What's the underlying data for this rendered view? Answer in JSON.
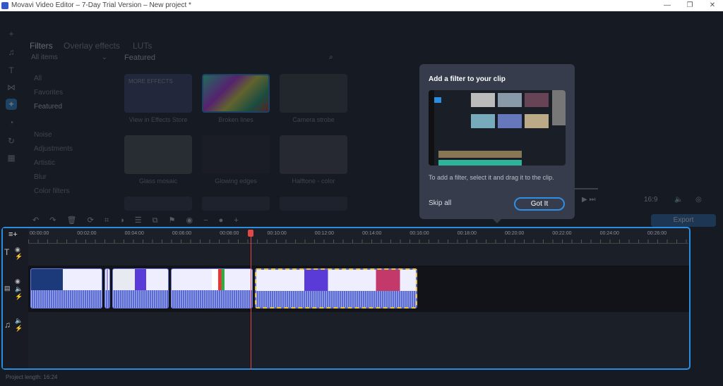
{
  "window": {
    "title": "Movavi Video Editor – 7-Day Trial Version – New project *"
  },
  "tabs": [
    "Filters",
    "Overlay effects",
    "LUTs"
  ],
  "category_select": "All items",
  "sidebar": [
    "All",
    "Favorites",
    "Featured",
    "Noise",
    "Adjustments",
    "Artistic",
    "Blur",
    "Color filters"
  ],
  "section_title": "Featured",
  "filters": [
    {
      "label": "View in Effects Store",
      "thumb_text": "MORE EFFECTS"
    },
    {
      "label": "Broken lines"
    },
    {
      "label": "Camera strobe"
    },
    {
      "label": "Glass mosaic"
    },
    {
      "label": "Glowing edges"
    },
    {
      "label": "Halftone - color"
    }
  ],
  "popup": {
    "title": "Add a filter to your clip",
    "text": "To add a filter, select it and drag it to the clip.",
    "skip": "Skip all",
    "confirm": "Got It"
  },
  "player": {
    "aspect": "16:9",
    "export": "Export"
  },
  "timeline": {
    "ticks": [
      "00:00:00",
      "00:02:00",
      "00:04:00",
      "00:06:00",
      "00:08:00",
      "00:10:00",
      "00:12:00",
      "00:14:00",
      "00:16:00",
      "00:18:00",
      "00:20:00",
      "00:22:00",
      "00:24:00",
      "00:26:00"
    ],
    "playhead": "00:09:00"
  },
  "footer": "Project length: 16:24",
  "colors": {
    "accent": "#2b8de0",
    "selection": "#e8c535",
    "playhead": "#e04848"
  }
}
